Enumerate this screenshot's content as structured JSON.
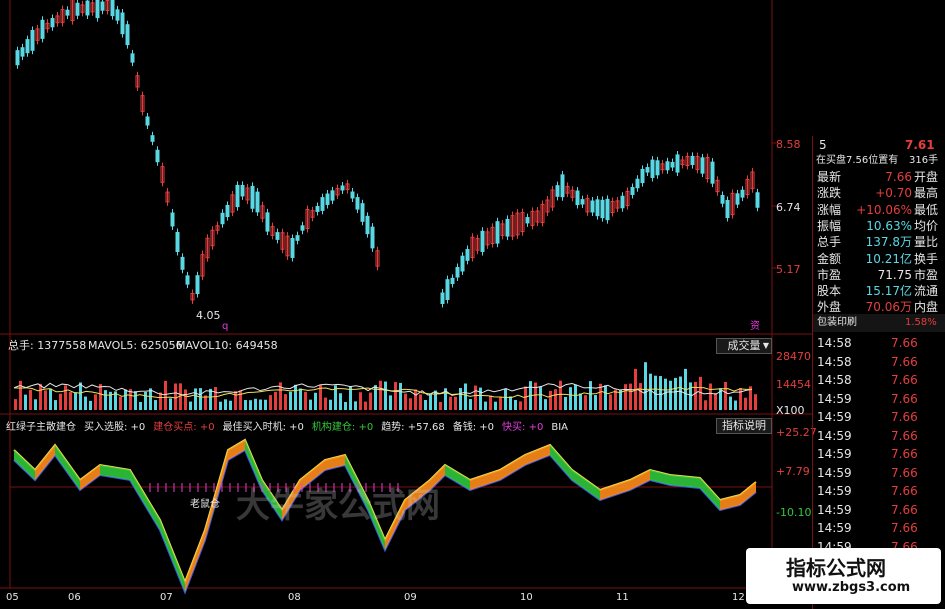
{
  "colors": {
    "up": "#e43e3e",
    "down": "#59d8e3",
    "ma_white": "#e6e6e6",
    "ma_yellow": "#f1e05a",
    "grid": "#7a1010",
    "yellow_line": "#e8d84a",
    "blue_line": "#3b56e6"
  },
  "main_chart": {
    "axis_labels": [
      "8.58",
      "6.74",
      "5.17"
    ],
    "low_label": "4.05",
    "markers": [
      "q",
      "资"
    ]
  },
  "volume_panel": {
    "label_vol": "总手: 1377558",
    "label_vol5": "MAVOL5: 625056",
    "label_vol10": "MAVOL10: 649458",
    "dropdown": "成交量",
    "axis_labels": [
      "28470",
      "14454",
      "X100"
    ]
  },
  "indicator_panel": {
    "header": [
      {
        "text": "红绿子主散建仓",
        "color": "#e6e6e6"
      },
      {
        "text": "买入选股: +0",
        "color": "#e6e6e6"
      },
      {
        "text": "建仓买点: +0",
        "color": "#e43e3e"
      },
      {
        "text": "最佳买入时机: +0",
        "color": "#e6e6e6"
      },
      {
        "text": "机构建仓: +0",
        "color": "#34c83a"
      },
      {
        "text": "趋势: +57.68",
        "color": "#e6e6e6"
      },
      {
        "text": "备钱: +0",
        "color": "#e6e6e6"
      },
      {
        "text": "快买: +0",
        "color": "#e43edc"
      },
      {
        "text": "BIA",
        "color": "#e6e6e6"
      }
    ],
    "help_button": "指标说明",
    "axis_labels": [
      "+25.27",
      "+7.79",
      "-10.10"
    ],
    "annotation": "老鼠仓"
  },
  "x_axis_labels": [
    "05",
    "06",
    "07",
    "08",
    "09",
    "10",
    "11",
    "12"
  ],
  "quote_panel": {
    "top_left": "5",
    "top_price": "7.61",
    "subheader_left": "在买盘7.56位置有",
    "subheader_right": "316手",
    "rows": [
      {
        "label": "最新",
        "value": "7.66",
        "label2": "开盘",
        "vcolor": "#e43e3e"
      },
      {
        "label": "涨跌",
        "value": "+0.70",
        "label2": "最高",
        "vcolor": "#e43e3e"
      },
      {
        "label": "涨幅",
        "value": "+10.06%",
        "label2": "最低",
        "vcolor": "#e43e3e"
      },
      {
        "label": "振幅",
        "value": "10.63%",
        "label2": "均价",
        "vcolor": "#59d8e3"
      },
      {
        "label": "总手",
        "value": "137.8万",
        "label2": "量比",
        "vcolor": "#59d8e3"
      },
      {
        "label": "金额",
        "value": "10.21亿",
        "label2": "换手",
        "vcolor": "#59d8e3"
      },
      {
        "label": "市盈",
        "value": "71.75",
        "label2": "市盈",
        "vcolor": "#e6e6e6"
      },
      {
        "label": "股本",
        "value": "15.17亿",
        "label2": "流通",
        "vcolor": "#59d8e3"
      },
      {
        "label": "外盘",
        "value": "70.06万",
        "label2": "内盘",
        "vcolor": "#e43e3e"
      }
    ],
    "banner_left": "包装印刷",
    "banner_right": "1.58%",
    "ticks": [
      {
        "time": "14:58",
        "price": "7.66"
      },
      {
        "time": "14:58",
        "price": "7.66"
      },
      {
        "time": "14:58",
        "price": "7.66"
      },
      {
        "time": "14:59",
        "price": "7.66"
      },
      {
        "time": "14:59",
        "price": "7.66"
      },
      {
        "time": "14:59",
        "price": "7.66"
      },
      {
        "time": "14:59",
        "price": "7.66"
      },
      {
        "time": "14:59",
        "price": "7.66"
      },
      {
        "time": "14:59",
        "price": "7.66"
      },
      {
        "time": "14:59",
        "price": "7.66"
      },
      {
        "time": "14:59",
        "price": "7.66"
      },
      {
        "time": "14:59",
        "price": "7.66"
      },
      {
        "time": "14:59",
        "price": "7.66"
      }
    ]
  },
  "watermark": "大牛家公式网",
  "logo": {
    "title": "指标公式网",
    "url": "www.zbgs3.com"
  }
}
